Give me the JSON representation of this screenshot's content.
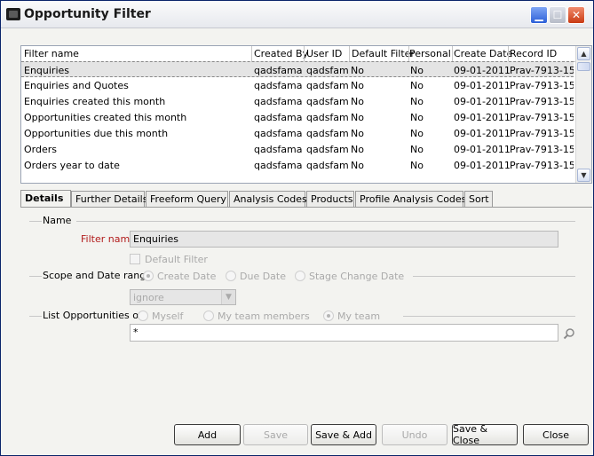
{
  "window": {
    "title": "Opportunity Filter"
  },
  "grid": {
    "columns": [
      "Filter name",
      "Created By",
      "User ID",
      "Default Filter",
      "Personal",
      "Create Date",
      "Record ID"
    ],
    "rows": [
      [
        "Enquiries",
        "qadsfama",
        "qadsfama",
        "No",
        "No",
        "09-01-2011",
        "Prav-7913-15"
      ],
      [
        "Enquiries and Quotes",
        "qadsfama",
        "qadsfama",
        "No",
        "No",
        "09-01-2011",
        "Prav-7913-15"
      ],
      [
        "Enquiries created this month",
        "qadsfama",
        "qadsfama",
        "No",
        "No",
        "09-01-2011",
        "Prav-7913-15"
      ],
      [
        "Opportunities created this month",
        "qadsfama",
        "qadsfama",
        "No",
        "No",
        "09-01-2011",
        "Prav-7913-15"
      ],
      [
        "Opportunities due this month",
        "qadsfama",
        "qadsfama",
        "No",
        "No",
        "09-01-2011",
        "Prav-7913-15"
      ],
      [
        "Orders",
        "qadsfama",
        "qadsfama",
        "No",
        "No",
        "09-01-2011",
        "Prav-7913-15"
      ],
      [
        "Orders year to date",
        "qadsfama",
        "qadsfama",
        "No",
        "No",
        "09-01-2011",
        "Prav-7913-15"
      ]
    ]
  },
  "tabs": [
    "Details",
    "Further Details",
    "Freeform Query",
    "Analysis Codes",
    "Products",
    "Profile Analysis Codes",
    "Sort"
  ],
  "details": {
    "name_group": "Name",
    "filter_name_label": "Filter name:",
    "filter_name_value": "Enquiries",
    "default_filter_label": "Default Filter",
    "scope_group": "Scope and Date range",
    "scope_options": [
      "Create Date",
      "Due Date",
      "Stage Change Date"
    ],
    "range_select_value": "ignore",
    "list_group": "List Opportunities of",
    "list_options": [
      "Myself",
      "My team members",
      "My team"
    ],
    "search_value": "*"
  },
  "buttons": {
    "add": "Add",
    "save": "Save",
    "save_add": "Save & Add",
    "undo": "Undo",
    "save_close": "Save & Close",
    "close": "Close"
  },
  "colors": {
    "title_border": "#0a246a",
    "required_label": "#b21c1c",
    "selected_row": "#e4e4e4"
  }
}
